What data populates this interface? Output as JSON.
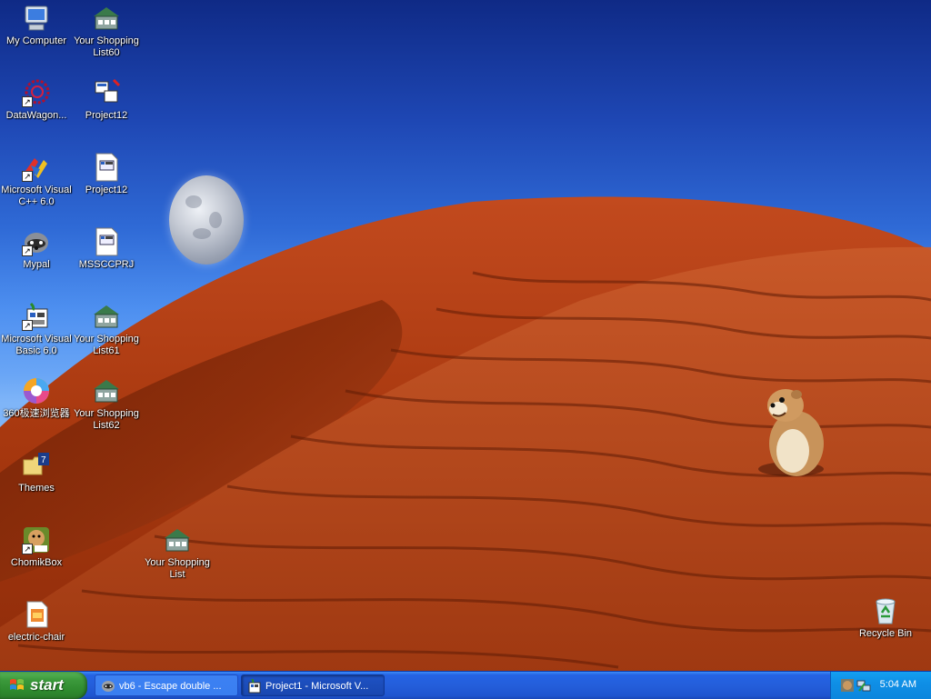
{
  "desktop": {
    "icons": [
      {
        "label": "My Computer",
        "icon": "my-computer-icon"
      },
      {
        "label": "Your Shopping List60",
        "icon": "shopping-list-house-icon"
      },
      {
        "label": "DataWagon...",
        "icon": "datawagon-icon"
      },
      {
        "label": "Project12",
        "icon": "vb-project-icon"
      },
      {
        "label": "Microsoft Visual C++ 6.0",
        "icon": "visual-cpp-icon"
      },
      {
        "label": "Project12",
        "icon": "vb-document-icon"
      },
      {
        "label": "Mypal",
        "icon": "mypal-raccoon-icon"
      },
      {
        "label": "MSSCCPRJ",
        "icon": "vb-document-icon"
      },
      {
        "label": "Microsoft Visual Basic 6.0",
        "icon": "visual-basic-icon"
      },
      {
        "label": "Your Shopping List61",
        "icon": "shopping-list-house-icon"
      },
      {
        "label": "360极速浏览器",
        "icon": "browser-360-icon"
      },
      {
        "label": "Your Shopping List62",
        "icon": "shopping-list-house-icon"
      },
      {
        "label": "Themes",
        "icon": "themes-folder-icon"
      },
      {
        "label": "ChomikBox",
        "icon": "chomikbox-icon"
      },
      {
        "label": "Your Shopping List",
        "icon": "shopping-list-house-icon"
      },
      {
        "label": "electric-chair",
        "icon": "electric-chair-file-icon"
      },
      {
        "label": "Recycle Bin",
        "icon": "recycle-bin-icon"
      }
    ]
  },
  "taskbar": {
    "start_label": "start",
    "tasks": [
      {
        "label": "vb6 - Escape double ...",
        "icon": "mypal-raccoon-icon",
        "active": false
      },
      {
        "label": "Project1 - Microsoft V...",
        "icon": "visual-basic-icon",
        "active": true
      }
    ],
    "tray": {
      "clock": "5:04 AM",
      "icons": [
        "chomikbox-tray-icon",
        "network-tray-icon"
      ]
    }
  },
  "colors": {
    "sky_top": "#0f2a86",
    "sand": "#b8431c",
    "taskbar": "#245edb",
    "start_green": "#3c9a3c",
    "tray": "#0f8fe6"
  }
}
